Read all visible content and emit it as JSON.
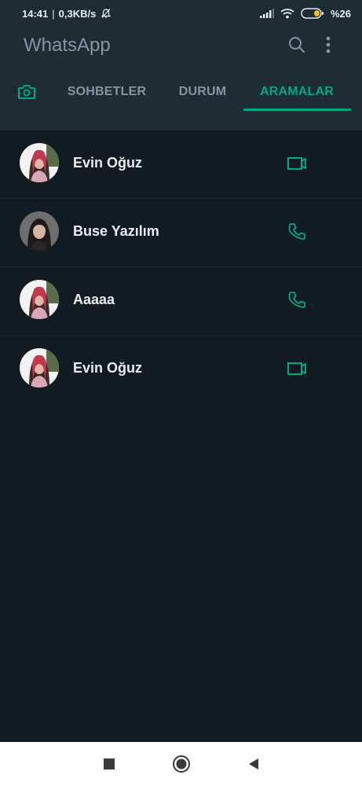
{
  "status": {
    "time": "14:41",
    "separator": "|",
    "speed": "0,3KB/s",
    "battery": "%26"
  },
  "app": {
    "title": "WhatsApp"
  },
  "tabs": [
    {
      "label": "SOHBETLER"
    },
    {
      "label": "DURUM"
    },
    {
      "label": "ARAMALAR",
      "active": true
    }
  ],
  "calls": [
    {
      "name": "Evin Oğuz",
      "type": "video"
    },
    {
      "name": "Buse Yazılım",
      "type": "voice"
    },
    {
      "name": "Aaaaa",
      "type": "voice"
    },
    {
      "name": "Evin Oğuz",
      "type": "video"
    }
  ],
  "colors": {
    "accent": "#00a884",
    "background": "#111b21",
    "header": "#1f2c34"
  }
}
